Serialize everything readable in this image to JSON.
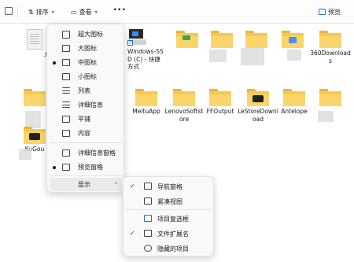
{
  "toolbar": {
    "sort_label": "排序",
    "view_label": "查看",
    "more_label": "···",
    "preview_label": "预览"
  },
  "files": {
    "txt_label": ".txt",
    "windows_ssd_label": "Windows-SSD (C) - 快捷方式",
    "downloads_360_label": "360Downloads",
    "meitu_label": "MeituApp",
    "lenovo_label": "LenovoSoftstore",
    "ffoutput_label": "FFOutput",
    "lestore_label": "LeStoreDownload",
    "antelope_label": "Antelope",
    "kugou_label": "KuGou"
  },
  "view_menu": {
    "items": [
      {
        "label": "超大图标",
        "selected": false
      },
      {
        "label": "大图标",
        "selected": false
      },
      {
        "label": "中图标",
        "selected": true
      },
      {
        "label": "小图标",
        "selected": false
      },
      {
        "label": "列表",
        "selected": false
      },
      {
        "label": "详细信息",
        "selected": false
      },
      {
        "label": "平铺",
        "selected": false
      },
      {
        "label": "内容",
        "selected": false
      }
    ],
    "pane_items": [
      {
        "label": "详细信息窗格",
        "selected": false
      },
      {
        "label": "预览窗格",
        "selected": true
      }
    ],
    "show_label": "显示",
    "show_arrow": "›"
  },
  "show_submenu": {
    "items": [
      {
        "label": "导航窗格",
        "checked": true
      },
      {
        "label": "紧凑视图",
        "checked": false
      },
      {
        "label": "项目复选框",
        "checked": false
      },
      {
        "label": "文件扩展名",
        "checked": true
      },
      {
        "label": "隐藏的项目",
        "checked": false
      }
    ],
    "check_glyph": "✓"
  },
  "colors": {
    "folder_yellow": "#f6c94e",
    "accent_blue": "#2a6fd6"
  }
}
